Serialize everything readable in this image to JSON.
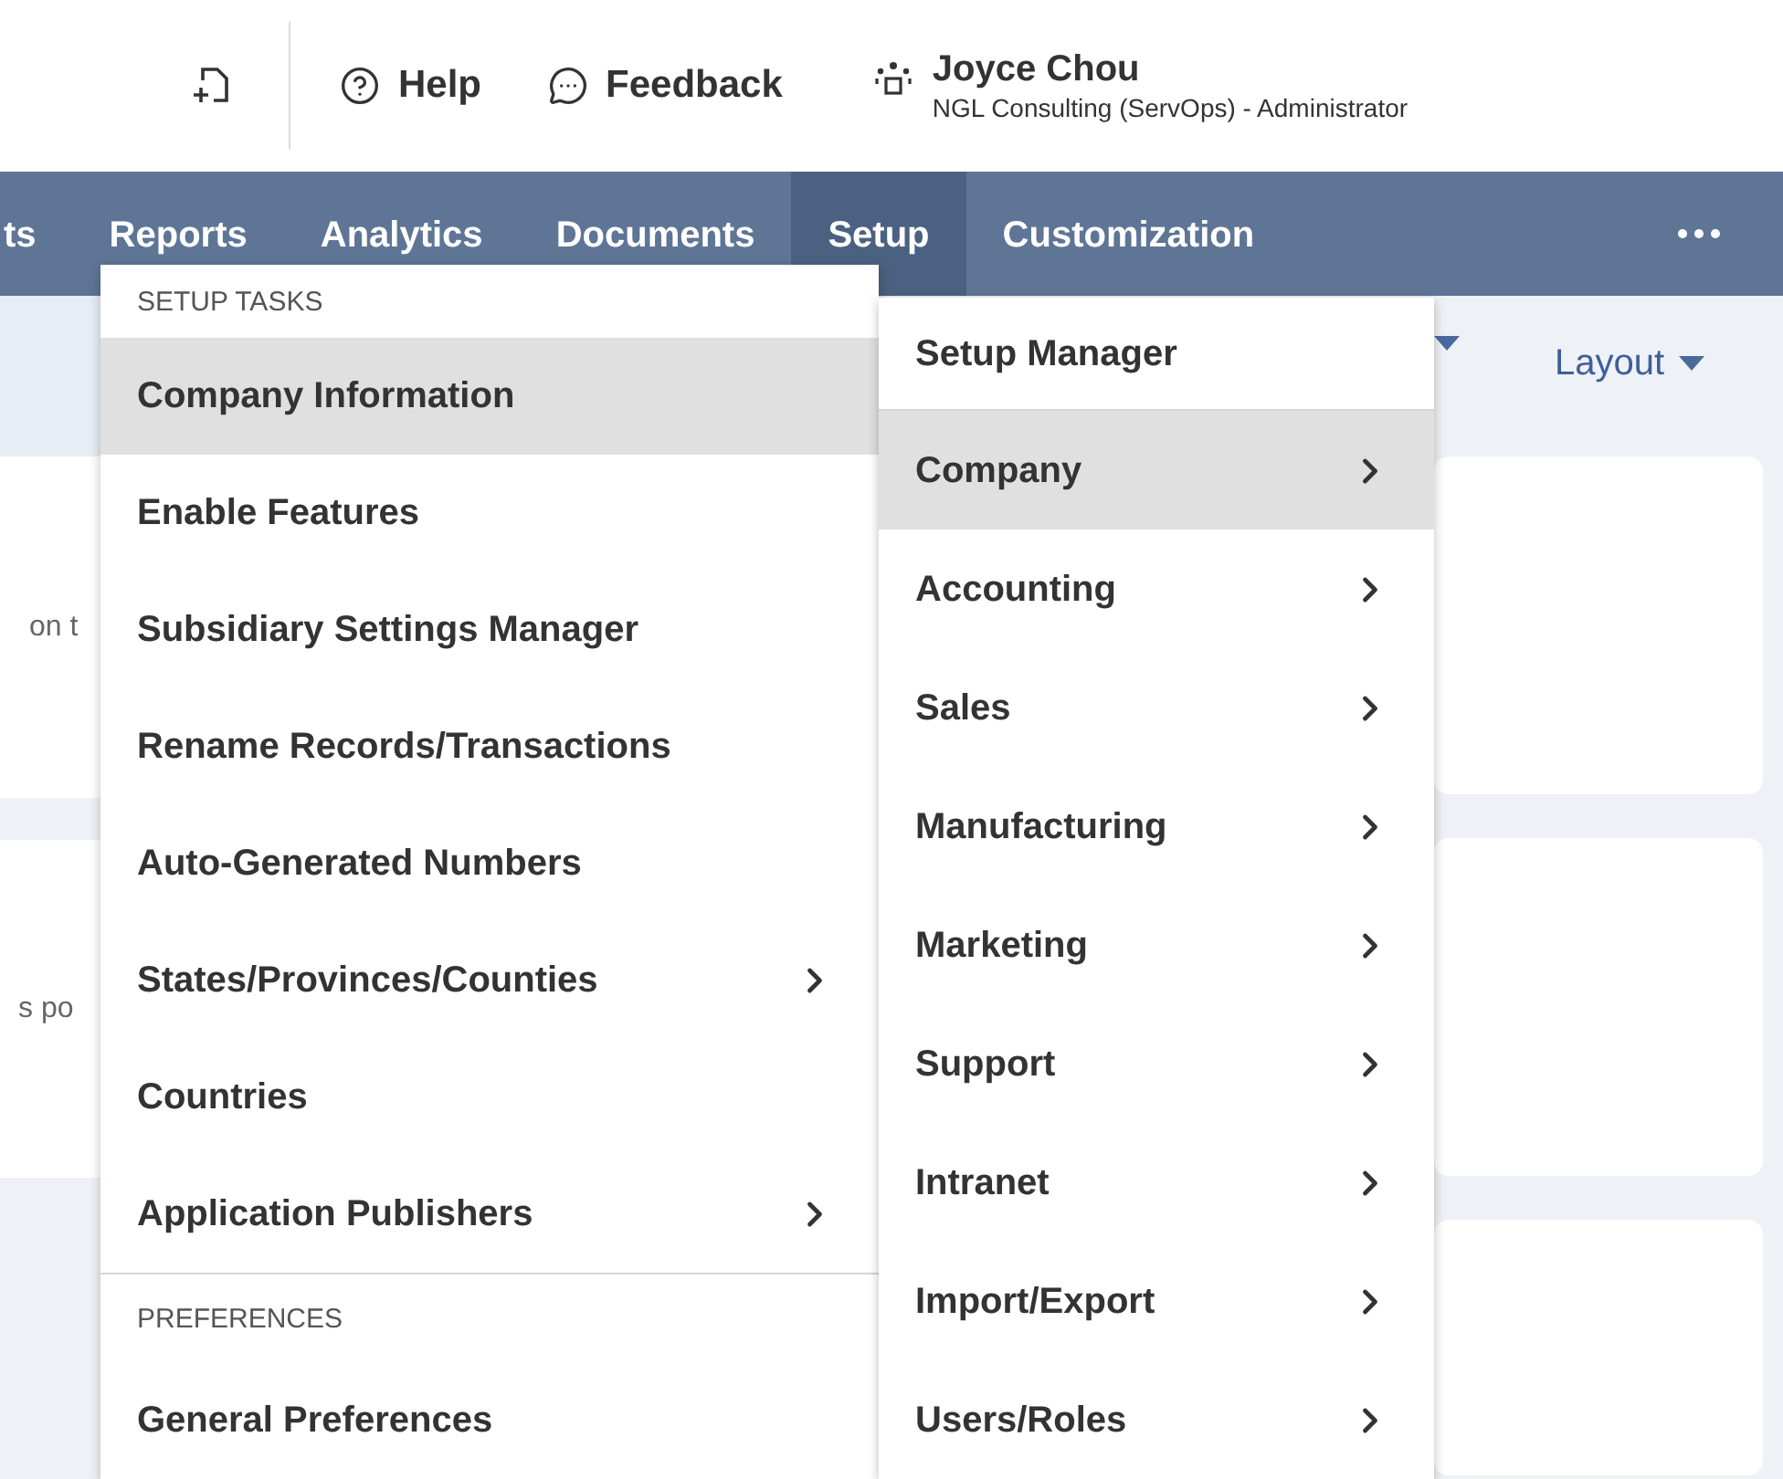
{
  "header": {
    "help": "Help",
    "feedback": "Feedback",
    "user": {
      "name": "Joyce Chou",
      "role": "NGL Consulting (ServOps) - Administrator"
    }
  },
  "nav": {
    "tabs": [
      {
        "label": "ts",
        "selected": false
      },
      {
        "label": "Reports",
        "selected": false
      },
      {
        "label": "Analytics",
        "selected": false
      },
      {
        "label": "Documents",
        "selected": false
      },
      {
        "label": "Setup",
        "selected": true
      },
      {
        "label": "Customization",
        "selected": false
      }
    ]
  },
  "toolbar": {
    "layout": "Layout"
  },
  "background_fragments": [
    "on t",
    "s po"
  ],
  "setup_menu": {
    "sections": [
      {
        "heading": "SETUP TASKS",
        "items": [
          {
            "label": "Company Information",
            "selected": true,
            "submenu": false
          },
          {
            "label": "Enable Features",
            "selected": false,
            "submenu": false
          },
          {
            "label": "Subsidiary Settings Manager",
            "selected": false,
            "submenu": false
          },
          {
            "label": "Rename Records/Transactions",
            "selected": false,
            "submenu": false
          },
          {
            "label": "Auto-Generated Numbers",
            "selected": false,
            "submenu": false
          },
          {
            "label": "States/Provinces/Counties",
            "selected": false,
            "submenu": true
          },
          {
            "label": "Countries",
            "selected": false,
            "submenu": false
          },
          {
            "label": "Application Publishers",
            "selected": false,
            "submenu": true
          }
        ]
      },
      {
        "heading": "PREFERENCES",
        "items": [
          {
            "label": "General Preferences",
            "selected": false,
            "submenu": false
          }
        ]
      }
    ]
  },
  "category_menu": {
    "top": "Setup Manager",
    "items": [
      {
        "label": "Company",
        "selected": true,
        "submenu": true
      },
      {
        "label": "Accounting",
        "selected": false,
        "submenu": true
      },
      {
        "label": "Sales",
        "selected": false,
        "submenu": true
      },
      {
        "label": "Manufacturing",
        "selected": false,
        "submenu": true
      },
      {
        "label": "Marketing",
        "selected": false,
        "submenu": true
      },
      {
        "label": "Support",
        "selected": false,
        "submenu": true
      },
      {
        "label": "Intranet",
        "selected": false,
        "submenu": true
      },
      {
        "label": "Import/Export",
        "selected": false,
        "submenu": true
      },
      {
        "label": "Users/Roles",
        "selected": false,
        "submenu": true
      }
    ]
  }
}
